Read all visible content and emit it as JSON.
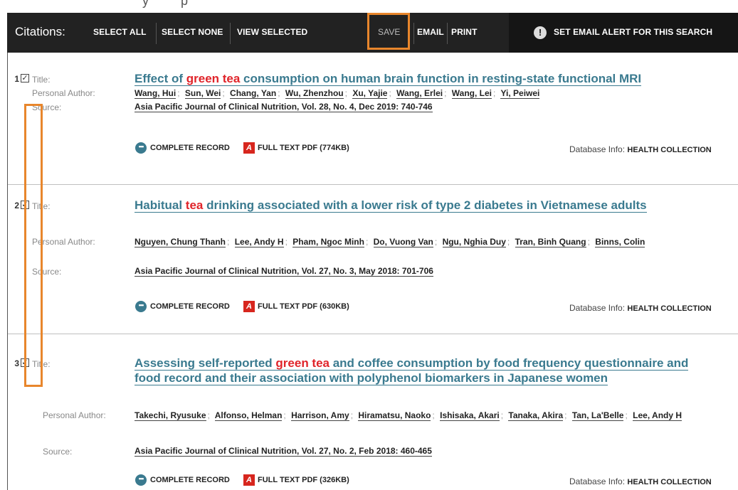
{
  "toolbar": {
    "title": "Citations:",
    "select_all": "SELECT ALL",
    "select_none": "SELECT NONE",
    "view_selected": "VIEW SELECTED",
    "save": "SAVE",
    "email": "EMAIL",
    "print": "PRINT",
    "alert_icon": "!",
    "alert_label": "SET EMAIL ALERT FOR THIS SEARCH"
  },
  "labels": {
    "title": "Title:",
    "personal_author": "Personal Author:",
    "source": "Source:",
    "database_info": "Database Info:",
    "complete_record": "COMPLETE RECORD"
  },
  "records": [
    {
      "number": "1",
      "checked": true,
      "title_parts": [
        "Effect of ",
        "green tea",
        " consumption on human brain function in resting-state functional MRI"
      ],
      "authors": [
        "Wang, Hui",
        "Sun, Wei",
        "Chang, Yan",
        "Wu, Zhenzhou",
        "Xu, Yajie",
        "Wang, Erlei",
        "Wang, Lei",
        "Yi, Peiwei"
      ],
      "source": "Asia Pacific Journal of Clinical Nutrition, Vol. 28, No. 4, Dec 2019: 740-746",
      "full_text": "FULL TEXT PDF (774KB)",
      "database": "HEALTH COLLECTION"
    },
    {
      "number": "2",
      "checked": true,
      "title_parts": [
        "Habitual ",
        "tea",
        " drinking associated with a lower risk of type 2 diabetes in Vietnamese adults"
      ],
      "authors": [
        "Nguyen, Chung Thanh",
        "Lee, Andy H",
        "Pham, Ngoc Minh",
        "Do, Vuong Van",
        "Ngu, Nghia Duy",
        "Tran, Binh Quang",
        "Binns, Colin"
      ],
      "source": "Asia Pacific Journal of Clinical Nutrition, Vol. 27, No. 3, May 2018: 701-706",
      "full_text": "FULL TEXT PDF (630KB)",
      "database": "HEALTH COLLECTION"
    },
    {
      "number": "3",
      "checked": true,
      "title_parts": [
        "Assessing self-reported ",
        "green tea",
        " and coffee consumption by food frequency questionnaire and food record and their association with polyphenol biomarkers in Japanese women"
      ],
      "authors": [
        "Takechi, Ryusuke",
        "Alfonso, Helman",
        "Harrison, Amy",
        "Hiramatsu, Naoko",
        "Ishisaka, Akari",
        "Tanaka, Akira",
        "Tan, La'Belle",
        "Lee, Andy H"
      ],
      "source": "Asia Pacific Journal of Clinical Nutrition, Vol. 27, No. 2, Feb 2018: 460-465",
      "full_text": "FULL TEXT PDF (326KB)",
      "database": "HEALTH COLLECTION"
    }
  ],
  "colors": {
    "toolbar_bg": "#222222",
    "title_link": "#3a7a8f",
    "highlight_term": "#e0242a",
    "annotation_box": "#e8862c"
  }
}
